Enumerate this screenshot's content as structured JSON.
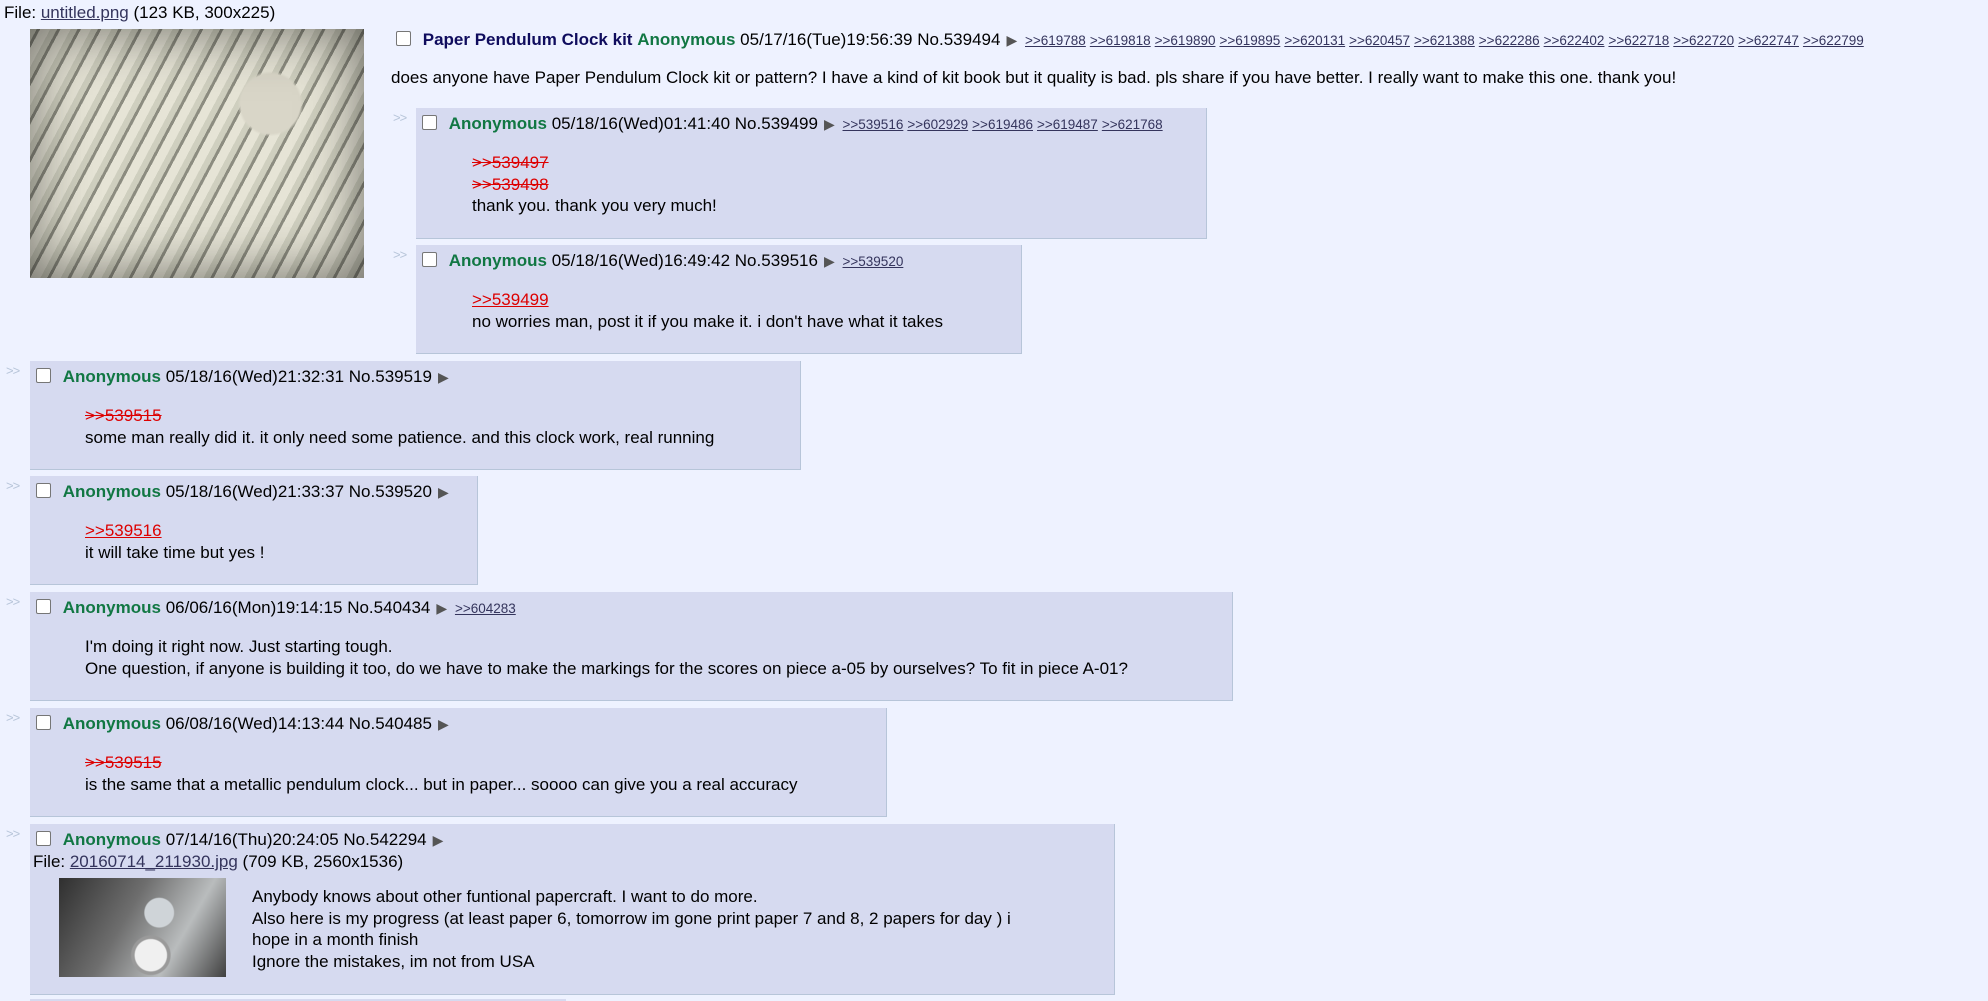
{
  "op": {
    "file_prefix": "File: ",
    "file_name": "untitled.png",
    "file_meta": " (123 KB, 300x225)",
    "subject": "Paper Pendulum Clock kit",
    "name": "Anonymous",
    "datetime": "05/17/16(Tue)19:56:39",
    "no_prefix": "No.",
    "post_no": "539494",
    "backlinks": [
      ">>619788",
      ">>619818",
      ">>619890",
      ">>619895",
      ">>620131",
      ">>620457",
      ">>621388",
      ">>622286",
      ">>622402",
      ">>622718",
      ">>622720",
      ">>622747",
      ">>622799"
    ],
    "text": "does anyone have Paper Pendulum Clock kit or pattern? I have a kind of kit book but it quality is bad. pls share if you have better. I really want to make this one. thank you!"
  },
  "side_arrows": ">>",
  "replies": [
    {
      "name": "Anonymous",
      "datetime": "05/18/16(Wed)01:41:40",
      "post_no": "539499",
      "backlinks": [
        ">>539516",
        ">>602929",
        ">>619486",
        ">>619487",
        ">>621768"
      ],
      "quotes_dead": [
        ">>539497",
        ">>539498"
      ],
      "lines": [
        "thank you. thank you very much!"
      ]
    },
    {
      "name": "Anonymous",
      "datetime": "05/18/16(Wed)16:49:42",
      "post_no": "539516",
      "backlinks": [
        ">>539520"
      ],
      "quote": ">>539499",
      "lines": [
        "no worries man, post it if you make it. i don't have what it takes"
      ]
    },
    {
      "name": "Anonymous",
      "datetime": "05/18/16(Wed)21:32:31",
      "post_no": "539519",
      "quote_dead": ">>539515",
      "lines": [
        "some man really did it. it only need some patience. and this clock work, real running"
      ]
    },
    {
      "name": "Anonymous",
      "datetime": "05/18/16(Wed)21:33:37",
      "post_no": "539520",
      "quote": ">>539516",
      "lines": [
        "it will take time but yes !"
      ]
    },
    {
      "name": "Anonymous",
      "datetime": "06/06/16(Mon)19:14:15",
      "post_no": "540434",
      "backlinks": [
        ">>604283"
      ],
      "lines": [
        "I'm doing it right now. Just starting tough.",
        "One question, if anyone is building it too, do we have to make the markings for the scores on piece a-05 by ourselves? To fit in piece A-01?"
      ]
    },
    {
      "name": "Anonymous",
      "datetime": "06/08/16(Wed)14:13:44",
      "post_no": "540485",
      "quote_dead": ">>539515",
      "lines": [
        "is the same that a metallic pendulum clock... but in paper... soooo can give you a real accuracy"
      ]
    },
    {
      "name": "Anonymous",
      "datetime": "07/14/16(Thu)20:24:05",
      "post_no": "542294",
      "file_prefix": "File: ",
      "file_name": "20160714_211930.jpg",
      "file_meta": " (709 KB, 2560x1536)",
      "lines": [
        "Anybody knows about other funtional papercraft. I want to do more.",
        "Also here is my progress (at least paper 6, tomorrow im gone print paper 7 and 8, 2 papers for day ) i",
        "hope in a month finish",
        "Ignore the mistakes, im not from USA"
      ]
    }
  ]
}
